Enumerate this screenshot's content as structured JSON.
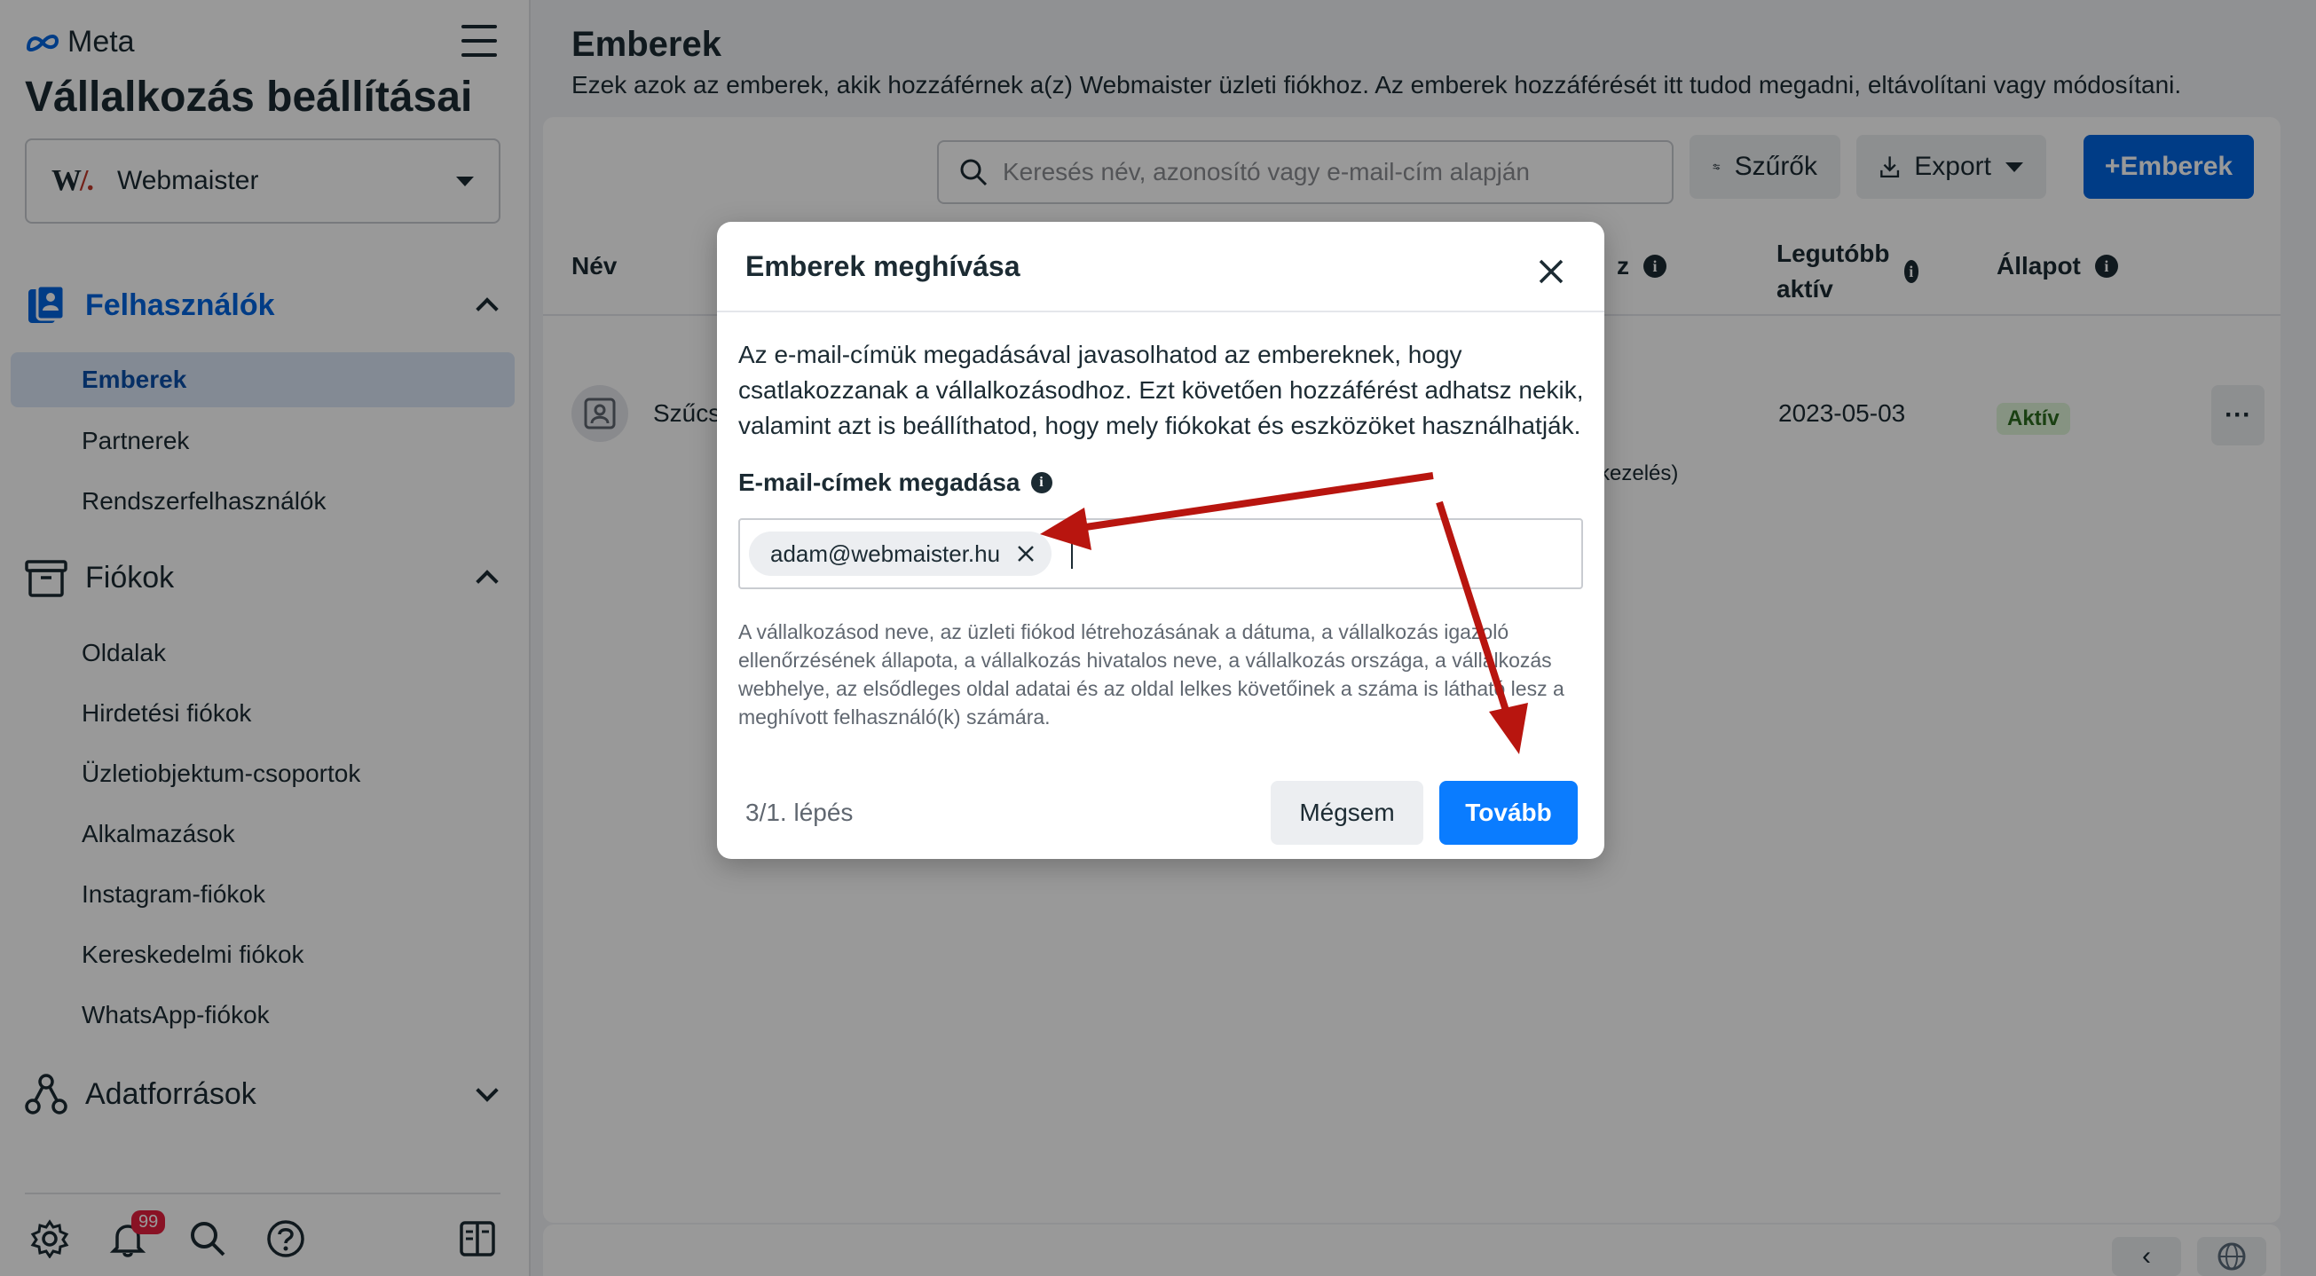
{
  "sidebar": {
    "brand": "Meta",
    "title": "Vállalkozás beállításai",
    "business": {
      "logo_text": "W/.",
      "name": "Webmaister"
    },
    "sections": {
      "users": "Felhasználók",
      "accounts": "Fiókok",
      "data_sources": "Adatforrások"
    },
    "users_items": [
      "Emberek",
      "Partnerek",
      "Rendszerfelhasználók"
    ],
    "accounts_items": [
      "Oldalak",
      "Hirdetési fiókok",
      "Üzletiobjektum-csoportok",
      "Alkalmazások",
      "Instagram-fiókok",
      "Kereskedelmi fiókok",
      "WhatsApp-fiókok"
    ],
    "notification_count": "99"
  },
  "main": {
    "title": "Emberek",
    "subtitle": "Ezek azok az emberek, akik hozzáférnek a(z) Webmaister üzleti fiókhoz. Az emberek hozzáférését itt tudod megadni, eltávolítani vagy módosítani.",
    "search_placeholder": "Keresés név, azonosító vagy e-mail-cím alapján",
    "filters_label": "Szűrők",
    "export_label": "Export",
    "add_people_label": "+Emberek",
    "columns": {
      "name": "Név",
      "access_partial": "z",
      "last_active": "Legutóbb aktív",
      "status": "Állapot"
    },
    "row": {
      "name_partial": "Szűcs",
      "access_partial": "kezelés)",
      "last_active": "2023-05-03",
      "status": "Aktív"
    }
  },
  "modal": {
    "title": "Emberek meghívása",
    "description": "Az e-mail-címük megadásával javasolhatod az embereknek, hogy csatlakozzanak a vállalkozásodhoz. Ezt követően hozzáférést adhatsz nekik, valamint azt is beállíthatod, hogy mely fiókokat és eszközöket használhatják.",
    "email_label": "E-mail-címek megadása",
    "email_chip": "adam@webmaister.hu",
    "note": "A vállalkozásod neve, az üzleti fiókod létrehozásának a dátuma, a vállalkozás igazoló ellenőrzésének állapota, a vállalkozás hivatalos neve, a vállalkozás országa, a vállalkozás webhelye, az elsődleges oldal adatai és az oldal lelkes követőinek a száma is látható lesz a meghívott felhasználó(k) számára.",
    "step": "3/1. lépés",
    "cancel_label": "Mégsem",
    "next_label": "Tovább"
  },
  "colors": {
    "accent": "#0064e0",
    "next_button": "#0a7cff",
    "annotation_arrow": "#b8150f",
    "active_status": "#2c6b1f"
  }
}
